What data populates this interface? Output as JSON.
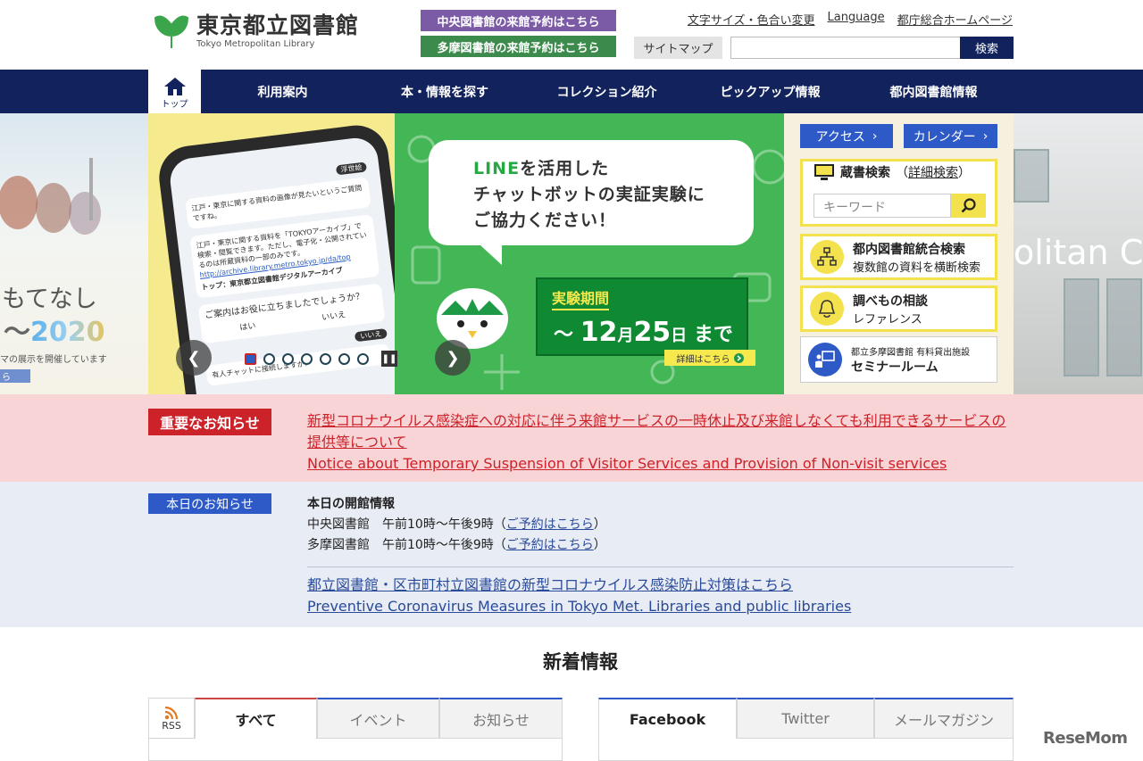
{
  "header": {
    "logo_jp": "東京都立図書館",
    "logo_en": "Tokyo Metropolitan Library",
    "reserve_central": "中央図書館の来館予約はこちら",
    "reserve_tama": "多摩図書館の来館予約はこちら",
    "top_links": [
      "文字サイズ・色合い変更",
      "Language",
      "都庁総合ホームページ"
    ],
    "sitemap": "サイトマップ",
    "search_value": "",
    "search_button": "検索"
  },
  "nav": {
    "home": "トップ",
    "items": [
      "利用案内",
      "本・情報を探す",
      "コレクション紹介",
      "ピックアップ情報",
      "都内図書館情報"
    ]
  },
  "hero": {
    "left_banner": {
      "line1": "もてなし",
      "line2_prefix": "～",
      "line2_num": "2020",
      "line3": "マの展示を開催しています",
      "line4": "ら"
    },
    "phone": {
      "badge": "浮世絵",
      "msg1": "江戸・東京に関する資料の画像が見たいというご質問ですね。",
      "msg2": "江戸・東京に関する資料を「TOKYOアーカイブ」で検索・閲覧できます。ただし、電子化・公開されているのは所蔵資料の一部のみです。",
      "link": "http://archive.library.metro.tokyo.jp/da/top",
      "card": "トップ：東京都立図書館デジタルアーカイブ",
      "question": "ご案内はお役に立ちましたでしょうか？",
      "yes": "はい",
      "no": "いいえ",
      "reply": "いいえ",
      "handoff": "有人チャットに接続しますか？"
    },
    "speech_line1_word": "LINE",
    "speech_line1_rest": "を活用した",
    "speech_line2": "チャットボットの実証実験に",
    "speech_line3": "ご協力ください！",
    "period_label": "実験期間",
    "period_prefix": "～",
    "period_month": "12",
    "period_month_unit": "月",
    "period_day": "25",
    "period_day_unit": "日",
    "period_suffix": "まで",
    "detail": "詳細はこちら",
    "slide_count": 7,
    "active_slide": 1,
    "building_text": "olitan Ce"
  },
  "side": {
    "access": "アクセス",
    "calendar": "カレンダー",
    "search_title": "蔵書検索",
    "search_adv_open": "（",
    "search_adv": "詳細検索",
    "search_adv_close": "）",
    "keyword_placeholder": "キーワード",
    "integrated_title": "都内図書館統合検索",
    "integrated_sub": "複数館の資料を横断検索",
    "reference_title": "調べもの相談",
    "reference_sub": "レファレンス",
    "seminar_small": "都立多摩図書館 有料貸出施設",
    "seminar_title": "セミナールーム"
  },
  "important": {
    "label": "重要なお知らせ",
    "links": [
      "新型コロナウイルス感染症への対応に伴う来館サービスの一時休止及び来館しなくても利用できるサービスの提供等について",
      "Notice about Temporary Suspension of Visitor Services and Provision of Non-visit services"
    ]
  },
  "today": {
    "label": "本日のお知らせ",
    "heading": "本日の開館情報",
    "central_name": "中央図書館",
    "central_hours": "午前10時～午後9時",
    "tama_name": "多摩図書館",
    "tama_hours": "午前10時～午後9時",
    "paren_open": "（",
    "reserve_link": "ご予約はこちら",
    "paren_close": "）",
    "covid_links": [
      "都立図書館・区市町村立図書館の新型コロナウイルス感染防止対策はこちら",
      "Preventive Coronavirus Measures in Tokyo Met. Libraries and public libraries"
    ]
  },
  "news": {
    "title": "新着情報",
    "rss": "RSS",
    "tabs_left": [
      "すべて",
      "イベント",
      "お知らせ"
    ],
    "tabs_right": [
      "Facebook",
      "Twitter",
      "メールマガジン"
    ]
  },
  "watermark": "ReseMom",
  "colors": {
    "navy": "#12225c",
    "blue": "#2d5ac6",
    "red": "#cc2229",
    "yellow": "#f3e14d",
    "green": "#43b756"
  }
}
